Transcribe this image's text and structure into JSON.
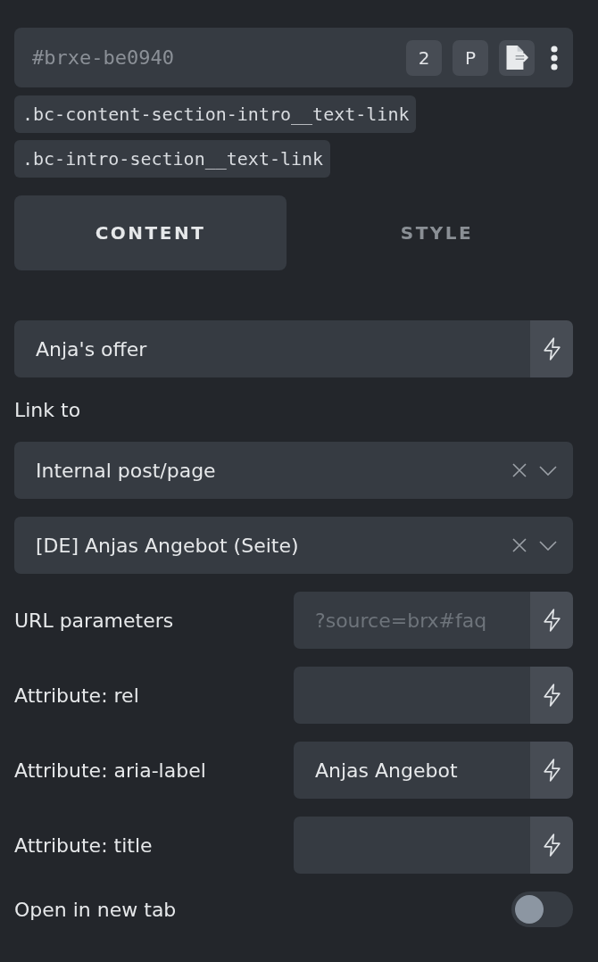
{
  "header": {
    "element_id": "#brxe-be0940",
    "buttons": [
      {
        "kind": "label",
        "label": "2"
      },
      {
        "kind": "label",
        "label": "P"
      },
      {
        "kind": "export"
      },
      {
        "kind": "more"
      }
    ]
  },
  "classes": [
    ".bc-content-section-intro__text-link",
    ".bc-intro-section__text-link"
  ],
  "tabs": [
    {
      "label": "CONTENT",
      "selected": true
    },
    {
      "label": "STYLE",
      "selected": false
    }
  ],
  "controls": [
    {
      "kind": "text",
      "value": "Anja's offer"
    },
    {
      "kind": "heading",
      "label": "Link to"
    },
    {
      "kind": "select",
      "value": "Internal post/page"
    },
    {
      "kind": "select",
      "value": "[DE] Anjas Angebot (Seite)"
    },
    {
      "kind": "input",
      "label": "URL parameters",
      "placeholder": "?source=brx#faq"
    },
    {
      "kind": "input",
      "label": "Attribute: rel"
    },
    {
      "kind": "input",
      "label": "Attribute: aria-label",
      "value": "Anjas Angebot"
    },
    {
      "kind": "input",
      "label": "Attribute: title"
    },
    {
      "kind": "toggle",
      "label": "Open in new tab",
      "on": false
    }
  ]
}
